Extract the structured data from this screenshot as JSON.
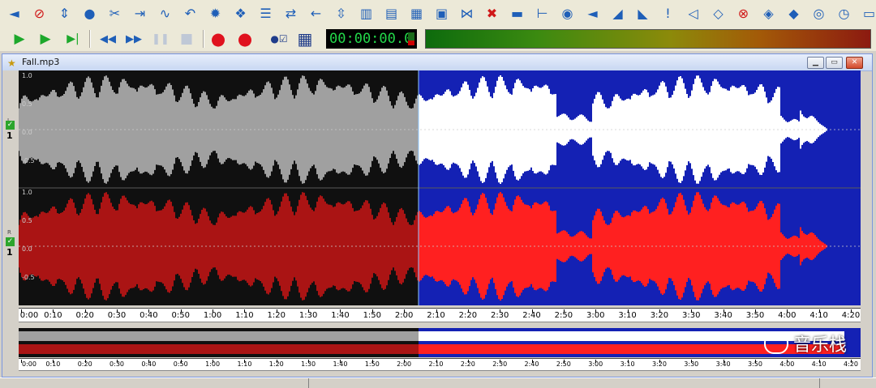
{
  "toolbar_top": {
    "icons": [
      "volume-left-icon",
      "no-entry-icon",
      "fit-vertical-icon",
      "globe-icon",
      "cut-icon",
      "split-icon",
      "curve-icon",
      "undo-icon",
      "gear-icon",
      "effects-icon",
      "align-icon",
      "swap-icon",
      "arrow-left-icon",
      "vertical-align-icon",
      "equalizer-icon",
      "spectrum-icon",
      "waveform-icon",
      "wav-icon",
      "trim-icon",
      "delete-icon",
      "paint-icon",
      "marker-icon",
      "speaker-icon",
      "volume-icon",
      "fade-in-icon",
      "fade-out-icon",
      "exclaim-icon",
      "mute-icon",
      "compare-icon",
      "no-noise-icon",
      "tag-icon",
      "diamond-icon",
      "eye-icon",
      "clock-icon",
      "monitor-icon"
    ]
  },
  "transport": {
    "play": "▶",
    "play_selection": "▶",
    "play_end": "▶|",
    "rewind": "◀◀",
    "forward": "▶▶",
    "pause": "❚❚",
    "stop": "■",
    "record": "●",
    "record_loop": "●",
    "vbadge": "●☑",
    "window": "▦"
  },
  "timer": "00:00:00.0",
  "document": {
    "title": "Fall.mp3"
  },
  "waveform": {
    "scale_labels": [
      "1.0",
      "0.5",
      "0.0",
      "-0.5"
    ],
    "channel_l_label": "L",
    "channel_r_label": "R",
    "channel_number": "1",
    "selection_end_fraction": 0.4745,
    "colors": {
      "background": "#1421b4",
      "selected_background": "#101010",
      "left_wave": "#ffffff",
      "left_wave_selected": "#a0a0a0",
      "right_wave": "#ff2020",
      "right_wave_selected": "#aa1414"
    }
  },
  "ruler_labels": [
    "0:00",
    "0:10",
    "0:20",
    "0:30",
    "0:40",
    "0:50",
    "1:00",
    "1:10",
    "1:20",
    "1:30",
    "1:40",
    "1:50",
    "2:00",
    "2:10",
    "2:20",
    "2:30",
    "2:40",
    "2:50",
    "3:00",
    "3:10",
    "3:20",
    "3:30",
    "3:40",
    "3:50",
    "4:00",
    "4:10",
    "4:20"
  ],
  "watermark": "音乐栈",
  "status_text": "_"
}
